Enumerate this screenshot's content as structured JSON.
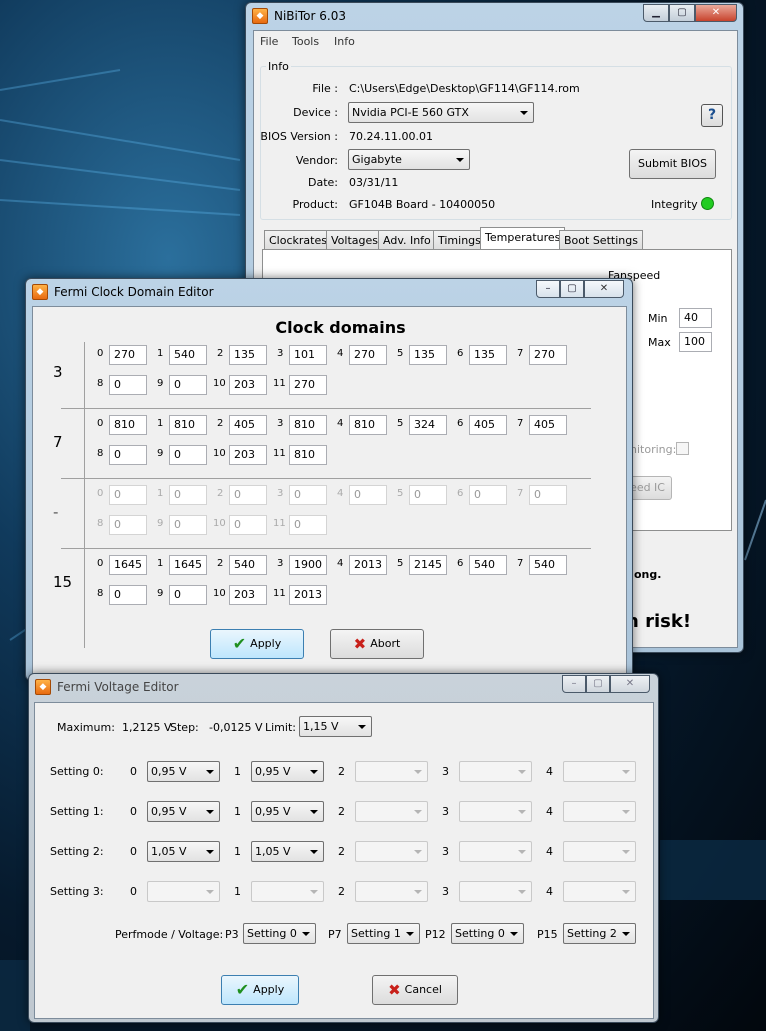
{
  "nibitor": {
    "title": "NiBiTor 6.03",
    "menu": [
      "File",
      "Tools",
      "Info"
    ],
    "info_group": "Info",
    "file_label": "File :",
    "file_value": "C:\\Users\\Edge\\Desktop\\GF114\\GF114.rom",
    "device_label": "Device :",
    "device_value": "Nvidia PCI-E 560 GTX",
    "bios_label": "BIOS Version :",
    "bios_value": "70.24.11.00.01",
    "vendor_label": "Vendor:",
    "vendor_value": "Gigabyte",
    "date_label": "Date:",
    "date_value": "03/31/11",
    "product_label": "Product:",
    "product_value": "GF104B Board - 10400050",
    "help_label": "?",
    "submit_label": "Submit BIOS",
    "integrity_label": "Integrity :",
    "integrity_color": "#22cc22",
    "tabs": [
      "Clockrates",
      "Voltages",
      "Adv. Info",
      "Timings",
      "Temperatures",
      "Boot Settings"
    ],
    "active_tab": "Temperatures",
    "fanspeed_label": "Fanspeed",
    "min_label": "Min",
    "min_value": "40",
    "max_label": "Max",
    "max_value": "100",
    "monitoring_label": "nitoring:",
    "speed_ic_label": "eed IC",
    "warning_partial": "ong.",
    "risk_partial": "n risk!"
  },
  "clock_editor": {
    "title": "Fermi Clock Domain Editor",
    "heading": "Clock domains",
    "rows": [
      {
        "label": "3",
        "disabled": false,
        "values": [
          "270",
          "540",
          "135",
          "101",
          "270",
          "135",
          "135",
          "270",
          "0",
          "0",
          "203",
          "270"
        ]
      },
      {
        "label": "7",
        "disabled": false,
        "values": [
          "810",
          "810",
          "405",
          "810",
          "810",
          "324",
          "405",
          "405",
          "0",
          "0",
          "203",
          "810"
        ]
      },
      {
        "label": "-",
        "disabled": true,
        "values": [
          "0",
          "0",
          "0",
          "0",
          "0",
          "0",
          "0",
          "0",
          "0",
          "0",
          "0",
          "0"
        ]
      },
      {
        "label": "15",
        "disabled": false,
        "values": [
          "1645",
          "1645",
          "540",
          "1900",
          "2013",
          "2145",
          "540",
          "540",
          "0",
          "0",
          "203",
          "2013"
        ]
      }
    ],
    "apply_label": "Apply",
    "abort_label": "Abort"
  },
  "voltage_editor": {
    "title": "Fermi Voltage Editor",
    "maximum_label": "Maximum:",
    "maximum_value": "1,2125 V",
    "step_label": "Step:",
    "step_value": "-0,0125 V",
    "limit_label": "Limit:",
    "limit_value": "1,15 V",
    "settings": [
      {
        "label": "Setting 0:",
        "values": [
          "0,95 V",
          "0,95 V",
          "",
          "",
          ""
        ]
      },
      {
        "label": "Setting 1:",
        "values": [
          "0,95 V",
          "0,95 V",
          "",
          "",
          ""
        ]
      },
      {
        "label": "Setting 2:",
        "values": [
          "1,05 V",
          "1,05 V",
          "",
          "",
          ""
        ]
      },
      {
        "label": "Setting 3:",
        "values": [
          "",
          "",
          "",
          "",
          ""
        ]
      }
    ],
    "perf_label": "Perfmode / Voltage:",
    "perf": [
      {
        "p": "P3",
        "value": "Setting 0"
      },
      {
        "p": "P7",
        "value": "Setting 1"
      },
      {
        "p": "P12",
        "value": "Setting 0"
      },
      {
        "p": "P15",
        "value": "Setting 2"
      }
    ],
    "apply_label": "Apply",
    "cancel_label": "Cancel"
  }
}
